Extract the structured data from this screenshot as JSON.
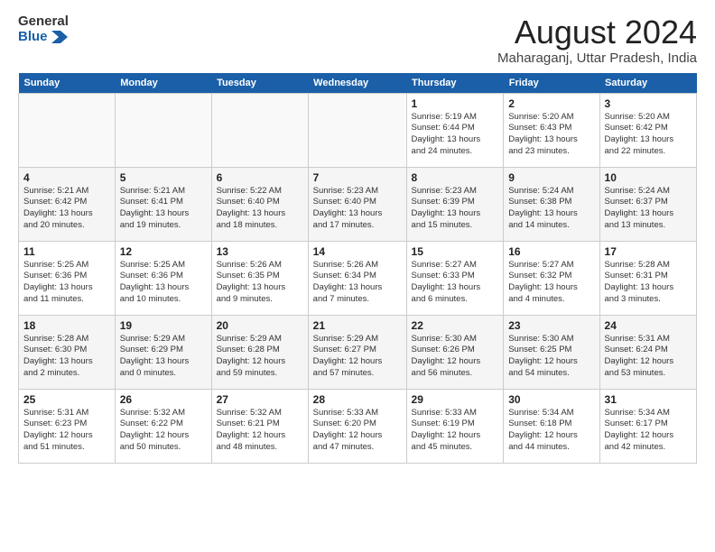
{
  "logo": {
    "line1": "General",
    "line2": "Blue"
  },
  "title": "August 2024",
  "location": "Maharaganj, Uttar Pradesh, India",
  "days_of_week": [
    "Sunday",
    "Monday",
    "Tuesday",
    "Wednesday",
    "Thursday",
    "Friday",
    "Saturday"
  ],
  "weeks": [
    [
      {
        "num": "",
        "info": ""
      },
      {
        "num": "",
        "info": ""
      },
      {
        "num": "",
        "info": ""
      },
      {
        "num": "",
        "info": ""
      },
      {
        "num": "1",
        "info": "Sunrise: 5:19 AM\nSunset: 6:44 PM\nDaylight: 13 hours\nand 24 minutes."
      },
      {
        "num": "2",
        "info": "Sunrise: 5:20 AM\nSunset: 6:43 PM\nDaylight: 13 hours\nand 23 minutes."
      },
      {
        "num": "3",
        "info": "Sunrise: 5:20 AM\nSunset: 6:42 PM\nDaylight: 13 hours\nand 22 minutes."
      }
    ],
    [
      {
        "num": "4",
        "info": "Sunrise: 5:21 AM\nSunset: 6:42 PM\nDaylight: 13 hours\nand 20 minutes."
      },
      {
        "num": "5",
        "info": "Sunrise: 5:21 AM\nSunset: 6:41 PM\nDaylight: 13 hours\nand 19 minutes."
      },
      {
        "num": "6",
        "info": "Sunrise: 5:22 AM\nSunset: 6:40 PM\nDaylight: 13 hours\nand 18 minutes."
      },
      {
        "num": "7",
        "info": "Sunrise: 5:23 AM\nSunset: 6:40 PM\nDaylight: 13 hours\nand 17 minutes."
      },
      {
        "num": "8",
        "info": "Sunrise: 5:23 AM\nSunset: 6:39 PM\nDaylight: 13 hours\nand 15 minutes."
      },
      {
        "num": "9",
        "info": "Sunrise: 5:24 AM\nSunset: 6:38 PM\nDaylight: 13 hours\nand 14 minutes."
      },
      {
        "num": "10",
        "info": "Sunrise: 5:24 AM\nSunset: 6:37 PM\nDaylight: 13 hours\nand 13 minutes."
      }
    ],
    [
      {
        "num": "11",
        "info": "Sunrise: 5:25 AM\nSunset: 6:36 PM\nDaylight: 13 hours\nand 11 minutes."
      },
      {
        "num": "12",
        "info": "Sunrise: 5:25 AM\nSunset: 6:36 PM\nDaylight: 13 hours\nand 10 minutes."
      },
      {
        "num": "13",
        "info": "Sunrise: 5:26 AM\nSunset: 6:35 PM\nDaylight: 13 hours\nand 9 minutes."
      },
      {
        "num": "14",
        "info": "Sunrise: 5:26 AM\nSunset: 6:34 PM\nDaylight: 13 hours\nand 7 minutes."
      },
      {
        "num": "15",
        "info": "Sunrise: 5:27 AM\nSunset: 6:33 PM\nDaylight: 13 hours\nand 6 minutes."
      },
      {
        "num": "16",
        "info": "Sunrise: 5:27 AM\nSunset: 6:32 PM\nDaylight: 13 hours\nand 4 minutes."
      },
      {
        "num": "17",
        "info": "Sunrise: 5:28 AM\nSunset: 6:31 PM\nDaylight: 13 hours\nand 3 minutes."
      }
    ],
    [
      {
        "num": "18",
        "info": "Sunrise: 5:28 AM\nSunset: 6:30 PM\nDaylight: 13 hours\nand 2 minutes."
      },
      {
        "num": "19",
        "info": "Sunrise: 5:29 AM\nSunset: 6:29 PM\nDaylight: 13 hours\nand 0 minutes."
      },
      {
        "num": "20",
        "info": "Sunrise: 5:29 AM\nSunset: 6:28 PM\nDaylight: 12 hours\nand 59 minutes."
      },
      {
        "num": "21",
        "info": "Sunrise: 5:29 AM\nSunset: 6:27 PM\nDaylight: 12 hours\nand 57 minutes."
      },
      {
        "num": "22",
        "info": "Sunrise: 5:30 AM\nSunset: 6:26 PM\nDaylight: 12 hours\nand 56 minutes."
      },
      {
        "num": "23",
        "info": "Sunrise: 5:30 AM\nSunset: 6:25 PM\nDaylight: 12 hours\nand 54 minutes."
      },
      {
        "num": "24",
        "info": "Sunrise: 5:31 AM\nSunset: 6:24 PM\nDaylight: 12 hours\nand 53 minutes."
      }
    ],
    [
      {
        "num": "25",
        "info": "Sunrise: 5:31 AM\nSunset: 6:23 PM\nDaylight: 12 hours\nand 51 minutes."
      },
      {
        "num": "26",
        "info": "Sunrise: 5:32 AM\nSunset: 6:22 PM\nDaylight: 12 hours\nand 50 minutes."
      },
      {
        "num": "27",
        "info": "Sunrise: 5:32 AM\nSunset: 6:21 PM\nDaylight: 12 hours\nand 48 minutes."
      },
      {
        "num": "28",
        "info": "Sunrise: 5:33 AM\nSunset: 6:20 PM\nDaylight: 12 hours\nand 47 minutes."
      },
      {
        "num": "29",
        "info": "Sunrise: 5:33 AM\nSunset: 6:19 PM\nDaylight: 12 hours\nand 45 minutes."
      },
      {
        "num": "30",
        "info": "Sunrise: 5:34 AM\nSunset: 6:18 PM\nDaylight: 12 hours\nand 44 minutes."
      },
      {
        "num": "31",
        "info": "Sunrise: 5:34 AM\nSunset: 6:17 PM\nDaylight: 12 hours\nand 42 minutes."
      }
    ]
  ]
}
